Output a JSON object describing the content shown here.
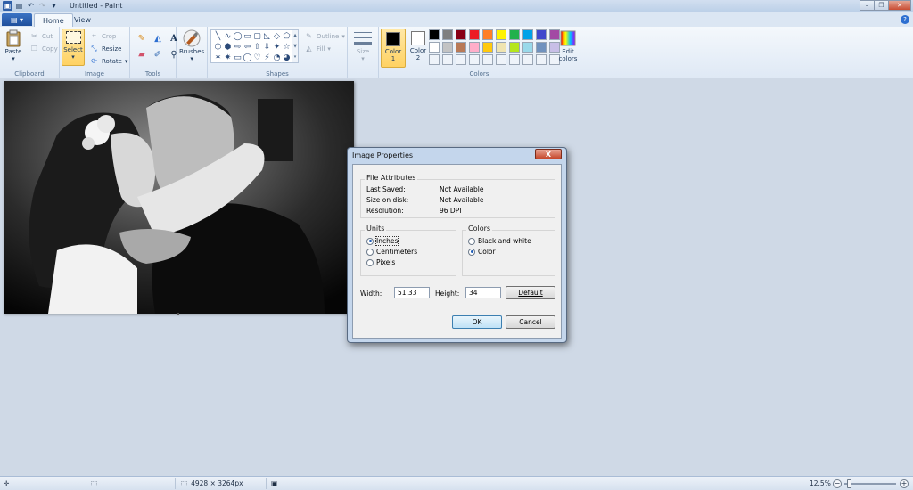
{
  "window": {
    "title": "Untitled - Paint",
    "minimize": "–",
    "restore": "❐",
    "close": "✕"
  },
  "quick_access": [
    "app-menu",
    "save",
    "undo",
    "redo",
    "customize"
  ],
  "tabs": {
    "file": "▤ ▾",
    "home": "Home",
    "view": "View",
    "help": "?"
  },
  "ribbon": {
    "clipboard": {
      "label": "Clipboard",
      "paste": "Paste",
      "cut": "Cut",
      "copy": "Copy"
    },
    "image": {
      "label": "Image",
      "select": "Select",
      "crop": "Crop",
      "resize": "Resize",
      "rotate": "Rotate"
    },
    "tools": {
      "label": "Tools",
      "items": [
        "pencil-icon",
        "fill-icon",
        "text-icon",
        "eraser-icon",
        "color-picker-icon",
        "magnifier-icon"
      ]
    },
    "brushes": {
      "label": "Brushes"
    },
    "shapes": {
      "label": "Shapes",
      "outline": "Outline",
      "fill": "Fill",
      "glyphs": [
        "╲",
        "∿",
        "◯",
        "▭",
        "▢",
        "◺",
        "◇",
        "⬠",
        "⬡",
        "⬢",
        "⇨",
        "⇦",
        "⇧",
        "⇩",
        "✦",
        "☆",
        "✶",
        "✷",
        "▭",
        "◯",
        "♡",
        "⚡",
        "◔",
        "◕"
      ]
    },
    "size": {
      "label": "Size"
    },
    "colors": {
      "label": "Colors",
      "color1": "Color 1",
      "color1_value": "#000000",
      "color2": "Color 2",
      "color2_value": "#ffffff",
      "edit": "Edit colors",
      "palette": [
        "#000000",
        "#7f7f7f",
        "#880015",
        "#ed1c24",
        "#ff7f27",
        "#fff200",
        "#22b14c",
        "#00a2e8",
        "#3f48cc",
        "#a349a4",
        "#ffffff",
        "#c3c3c3",
        "#b97a57",
        "#ffaec9",
        "#ffc90e",
        "#efe4b0",
        "#b5e61d",
        "#99d9ea",
        "#7092be",
        "#c8bfe7",
        "#eef3f9",
        "#eef3f9",
        "#eef3f9",
        "#eef3f9",
        "#eef3f9",
        "#eef3f9",
        "#eef3f9",
        "#eef3f9",
        "#eef3f9",
        "#eef3f9"
      ]
    }
  },
  "dialog": {
    "title": "Image Properties",
    "close": "X",
    "file_attributes": {
      "label": "File Attributes",
      "rows": [
        {
          "key": "Last Saved:",
          "value": "Not Available"
        },
        {
          "key": "Size on disk:",
          "value": "Not Available"
        },
        {
          "key": "Resolution:",
          "value": "96 DPI"
        }
      ]
    },
    "units": {
      "label": "Units",
      "options": [
        "Inches",
        "Centimeters",
        "Pixels"
      ],
      "selected": "Inches"
    },
    "colors": {
      "label": "Colors",
      "options": [
        "Black and white",
        "Color"
      ],
      "selected": "Color"
    },
    "width_label": "Width:",
    "width": "51.33",
    "height_label": "Height:",
    "height": "34",
    "default_btn": "Default",
    "ok_btn": "OK",
    "cancel_btn": "Cancel"
  },
  "status": {
    "dimensions": "4928 × 3264px",
    "zoom": "12.5%",
    "zoom_level_percent": 12.5,
    "zoom_out": "−",
    "zoom_in": "+"
  }
}
